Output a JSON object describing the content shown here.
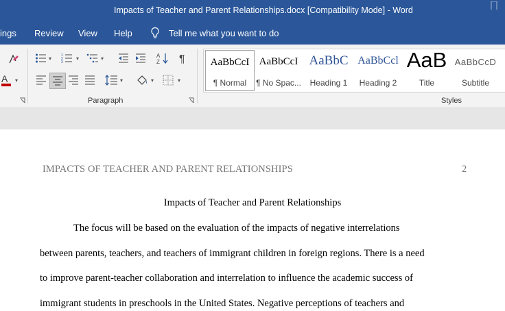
{
  "window": {
    "title": "Impacts of Teacher and Parent Relationships.docx [Compatibility Mode]  -  Word"
  },
  "menu": {
    "tabs": [
      "ings",
      "Review",
      "View",
      "Help"
    ],
    "tell_me": "Tell me what you want to do"
  },
  "ribbon": {
    "paragraph_group_label": "Paragraph",
    "styles_group_label": "Styles",
    "styles": [
      {
        "sample": "AaBbCcI",
        "name": "¶ Normal"
      },
      {
        "sample": "AaBbCcI",
        "name": "¶ No Spac..."
      },
      {
        "sample": "AaBbC",
        "name": "Heading 1"
      },
      {
        "sample": "AaBbCcl",
        "name": "Heading 2"
      },
      {
        "sample": "AaB",
        "name": "Title"
      },
      {
        "sample": "AaBbCcD",
        "name": "Subtitle"
      }
    ],
    "colors": {
      "accent": "#2b579a",
      "font_color_bar": "#c00000",
      "heading_blue": "#2f5496"
    }
  },
  "document": {
    "running_header": "IMPACTS OF TEACHER AND PARENT RELATIONSHIPS",
    "page_number": "2",
    "title": "Impacts of Teacher and Parent Relationships",
    "lines": [
      "The focus will be based on the evaluation of the impacts of negative interrelations",
      "between parents, teachers, and teachers of immigrant children in foreign regions. There is a need",
      "to improve parent-teacher collaboration and interrelation to influence the academic success of",
      "immigrant students in preschools in the United States. Negative perceptions of teachers and"
    ]
  }
}
